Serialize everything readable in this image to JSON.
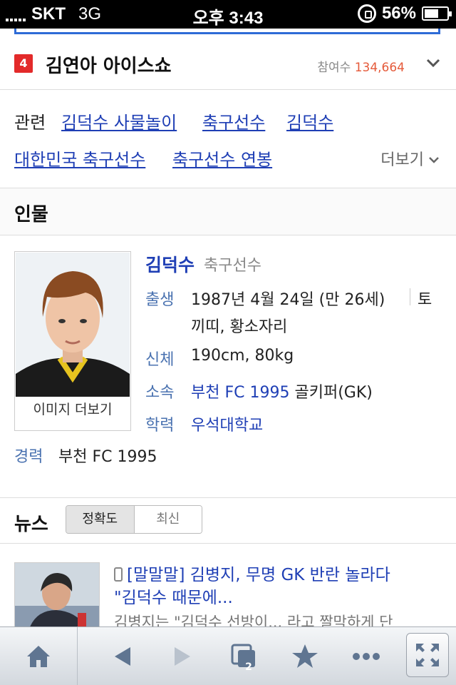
{
  "status_bar": {
    "carrier": "SKT",
    "network": "3G",
    "time": "오후 3:43",
    "battery": "56%"
  },
  "trend": {
    "rank": "4",
    "title": "김연아 아이스쇼",
    "participants_label": "참여수",
    "participants_count": "134,664"
  },
  "related": {
    "label": "관련",
    "links": [
      "김덕수 사물놀이",
      "축구선수",
      "김덕수",
      "대한민국 축구선수",
      "축구선수 연봉"
    ],
    "more": "더보기"
  },
  "person_section": {
    "title": "인물",
    "name": "김덕수",
    "occupation": "축구선수",
    "image_more": "이미지 더보기",
    "birth_label": "출생",
    "birth_line1": "1987년 4월 24일 (만 26세)",
    "birth_line1b": "토",
    "birth_line2": "끼띠, 황소자리",
    "body_label": "신체",
    "body_value": "190cm, 80kg",
    "team_label": "소속",
    "team_link": "부천 FC 1995",
    "team_position": "골키퍼(GK)",
    "edu_label": "학력",
    "edu_link": "우석대학교",
    "career_label": "경력",
    "career_value": "부천 FC 1995"
  },
  "news": {
    "title": "뉴스",
    "tabs": [
      "정확도",
      "최신"
    ],
    "active_tab": "정확도",
    "item_headline_1": "[말말말] 김병지, 무명 GK 반란 놀라다",
    "item_headline_2": "\"김덕수 때문에...",
    "item_snippet": "김병지는 \"김덕수 선방이... 라고 짤막하게 단"
  },
  "toolbar": {
    "tab_count": "2",
    "icons": [
      "home-icon",
      "back-icon",
      "forward-icon",
      "tabs-icon",
      "bookmark-star-icon",
      "more-icon",
      "fullscreen-icon"
    ]
  },
  "colors": {
    "link": "#1f3fb5",
    "rank_badge": "#e32a2a",
    "count": "#e55a3a",
    "label": "#4a72b0"
  }
}
